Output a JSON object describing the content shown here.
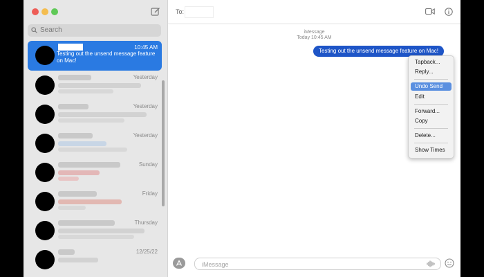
{
  "window": {
    "traffic_lights": [
      "close",
      "minimize",
      "zoom"
    ],
    "colors": {
      "close": "#ee5d57",
      "minimize": "#f4bd4f",
      "zoom": "#5fc957",
      "accent": "#2a7ae2",
      "bubble": "#1e55c7"
    }
  },
  "sidebar": {
    "search_placeholder": "Search",
    "conversations": [
      {
        "time": "10:45 AM",
        "preview": "Testing out the unsend message feature on Mac!",
        "selected": true
      },
      {
        "time": "Yesterday",
        "preview": "",
        "selected": false
      },
      {
        "time": "Yesterday",
        "preview": "",
        "selected": false
      },
      {
        "time": "Yesterday",
        "preview": "",
        "selected": false
      },
      {
        "time": "Sunday",
        "preview": "",
        "selected": false
      },
      {
        "time": "Friday",
        "preview": "",
        "selected": false
      },
      {
        "time": "Thursday",
        "preview": "",
        "selected": false
      },
      {
        "time": "12/25/22",
        "preview": "",
        "selected": false
      }
    ]
  },
  "header": {
    "to_label": "To:",
    "icons": [
      "video-icon",
      "info-icon"
    ]
  },
  "thread": {
    "service": "iMessage",
    "timestamp": "Today 10:45 AM",
    "message": "Testing out the unsend message feature on Mac!"
  },
  "context_menu": {
    "items": [
      {
        "label": "Tapback...",
        "highlighted": false
      },
      {
        "label": "Reply...",
        "highlighted": false
      },
      {
        "label": "Undo Send",
        "highlighted": true
      },
      {
        "label": "Edit",
        "highlighted": false
      },
      {
        "label": "Forward...",
        "highlighted": false
      },
      {
        "label": "Copy",
        "highlighted": false
      },
      {
        "label": "Delete...",
        "highlighted": false
      },
      {
        "label": "Show Times",
        "highlighted": false
      }
    ]
  },
  "composer": {
    "placeholder": "iMessage"
  }
}
